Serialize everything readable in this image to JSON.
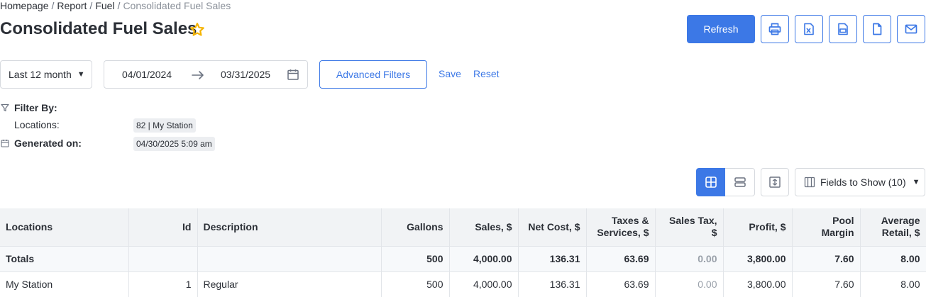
{
  "breadcrumb": {
    "items": [
      "Homepage",
      "Report",
      "Fuel"
    ],
    "current": "Consolidated Fuel Sales",
    "separator": "/"
  },
  "page": {
    "title": "Consolidated Fuel Sales"
  },
  "toolbar": {
    "refresh_label": "Refresh",
    "icons": [
      "print-icon",
      "excel-export-icon",
      "pdf-export-icon",
      "file-icon",
      "email-icon"
    ]
  },
  "filters": {
    "period": "Last 12 month",
    "date_from": "04/01/2024",
    "date_to": "03/31/2025",
    "advanced_label": "Advanced Filters",
    "save_label": "Save",
    "reset_label": "Reset"
  },
  "filter_info": {
    "filter_by_label": "Filter By:",
    "locations_label": "Locations:",
    "locations_value": "82 | My Station",
    "generated_label": "Generated on:",
    "generated_value": "04/30/2025 5:09 am"
  },
  "view": {
    "fields_label": "Fields to Show (10)"
  },
  "table": {
    "columns": [
      "Locations",
      "Id",
      "Description",
      "Gallons",
      "Sales, $",
      "Net Cost, $",
      "Taxes & Services, $",
      "Sales Tax, $",
      "Profit, $",
      "Pool Margin",
      "Average Retail, $"
    ],
    "totals": [
      "Totals",
      "",
      "",
      "500",
      "4,000.00",
      "136.31",
      "63.69",
      "0.00",
      "3,800.00",
      "7.60",
      "8.00"
    ],
    "rows": [
      [
        "My Station",
        "1",
        "Regular",
        "500",
        "4,000.00",
        "136.31",
        "63.69",
        "0.00",
        "3,800.00",
        "7.60",
        "8.00"
      ]
    ]
  },
  "colors": {
    "accent": "#3c78e6",
    "star": "#f5b400",
    "header_bg": "#f1f3f5"
  }
}
